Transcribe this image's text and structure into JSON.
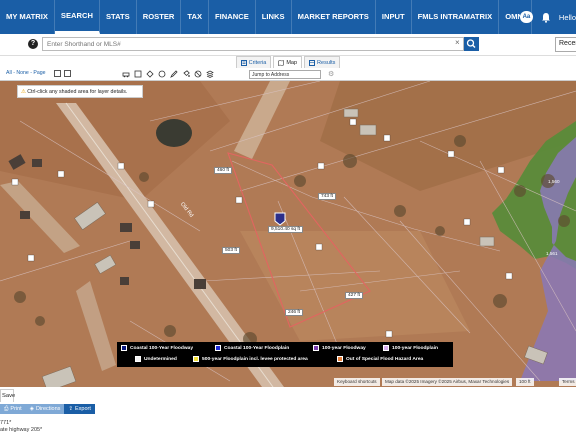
{
  "nav": {
    "items": [
      "MY MATRIX",
      "SEARCH",
      "STATS",
      "ROSTER",
      "TAX",
      "FINANCE",
      "LINKS",
      "MARKET REPORTS",
      "INPUT",
      "FMLS INTRAMATRIX",
      "OMNI"
    ],
    "aa_label": "Aa",
    "hello": "Hello"
  },
  "search": {
    "placeholder": "Enter Shorthand or MLS#",
    "clear": "×",
    "recent": "Recent"
  },
  "views": {
    "criteria": "Criteria",
    "map": "Map",
    "results": "Results"
  },
  "toolbar": {
    "all": "All",
    "none": "None",
    "page": "Page",
    "jump": "Jump to Address"
  },
  "map": {
    "tip": "Ctrl-click any shaded area for layer details.",
    "road_label": "Old Rd",
    "dims": [
      "460 ft",
      "743 ft",
      "503 ft",
      "427 ft",
      "246 ft"
    ],
    "area": "9,510.40 sq ft",
    "marker_color": "#2c2f8a",
    "elevation": [
      "1,560",
      "1,561"
    ]
  },
  "legend": [
    {
      "label": "Coastal 100-Year Floodway",
      "color": "#0a1a80"
    },
    {
      "label": "Coastal 100-Year Floodplain",
      "color": "#1d2bd6"
    },
    {
      "label": "100-year Floodway",
      "color": "#7b3fb0"
    },
    {
      "label": "100-year Floodplain",
      "color": "#d8b0f0"
    },
    {
      "label": "Undetermined",
      "color": "#f2f2f2"
    },
    {
      "label": "500-year Floodplain incl. levee protected area",
      "color": "#f4e23a"
    },
    {
      "label": "Out of Special Flood Hazard Area",
      "color": "#e8803a"
    }
  ],
  "attribution": {
    "keyboard": "Keyboard shortcuts",
    "data": "Map data ©2025 Imagery ©2025 Airbus, Maxar Technologies",
    "scale": "100 ft",
    "terms": "Terms"
  },
  "bottom": {
    "save": "Save",
    "buttons": [
      "Print",
      "Directions",
      "Export"
    ],
    "addr1": "771*",
    "addr2": "ate highway 205*"
  }
}
